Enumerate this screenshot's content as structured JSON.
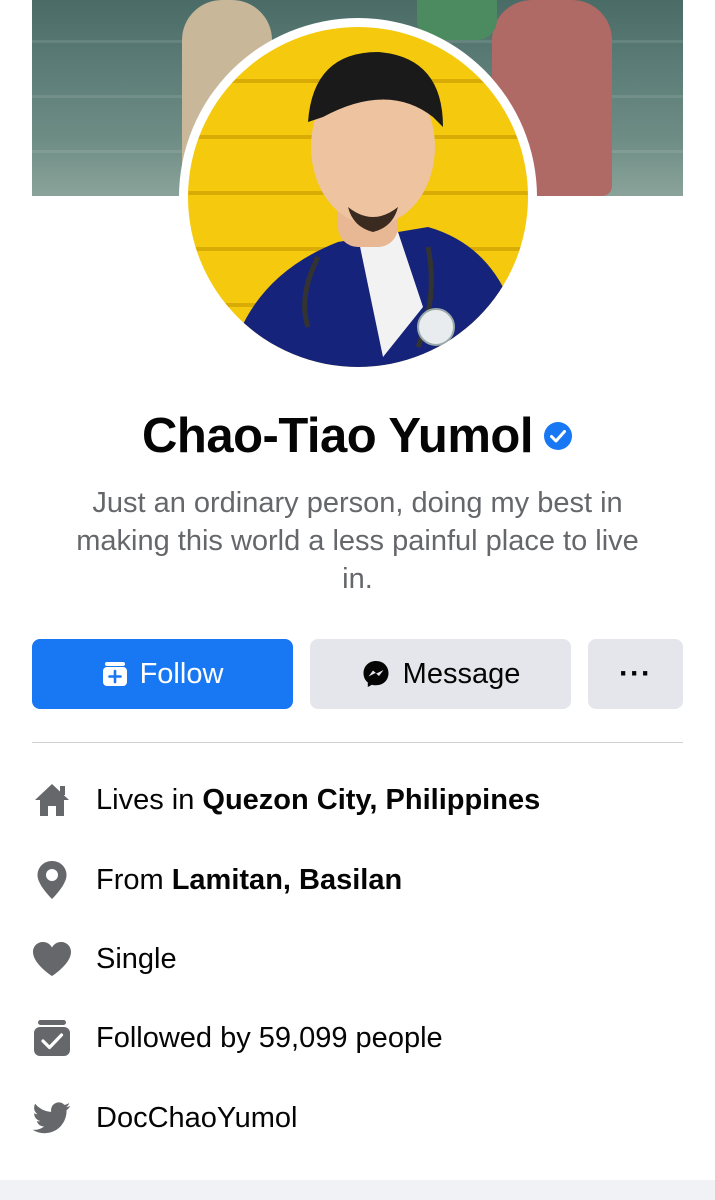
{
  "profile": {
    "name": "Chao-Tiao Yumol",
    "verified_icon": "verified-badge-icon",
    "bio": "Just an ordinary person, doing my best in making this world a less painful place to live in."
  },
  "actions": {
    "follow_label": "Follow",
    "message_label": "Message",
    "more_label": "···"
  },
  "intro": {
    "lives_prefix": "Lives in ",
    "lives_place": "Quezon City, Philippines",
    "from_prefix": "From ",
    "from_place": "Lamitan, Basilan",
    "relationship": "Single",
    "followers_text": "Followed by 59,099 people",
    "twitter_handle": "DocChaoYumol"
  },
  "colors": {
    "accent": "#1877f2",
    "secondary_button": "#e4e6eb",
    "muted_text": "#65676b",
    "icon_gray": "#65676b"
  }
}
